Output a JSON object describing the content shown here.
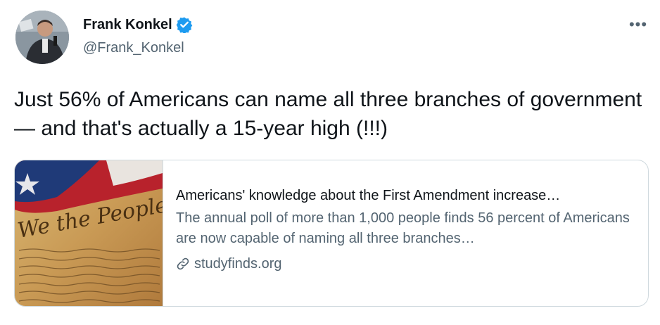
{
  "author": {
    "name": "Frank Konkel",
    "handle": "@Frank_Konkel",
    "verified": true
  },
  "menu": {
    "more_label": "•••"
  },
  "tweet": {
    "text": "Just 56% of Americans can name all three branches of government — and that's actually a 15-year high (!!!)"
  },
  "card": {
    "title": "Americans' knowledge about the First Amendment increase…",
    "description": "The annual poll of more than 1,000 people finds 56 percent of Americans are now capable of naming all three branches…",
    "domain": "studyfinds.org",
    "image_text": "We the People"
  },
  "colors": {
    "verified_blue": "#1d9bf0",
    "secondary_text": "#536471",
    "border": "#cfd9de"
  }
}
